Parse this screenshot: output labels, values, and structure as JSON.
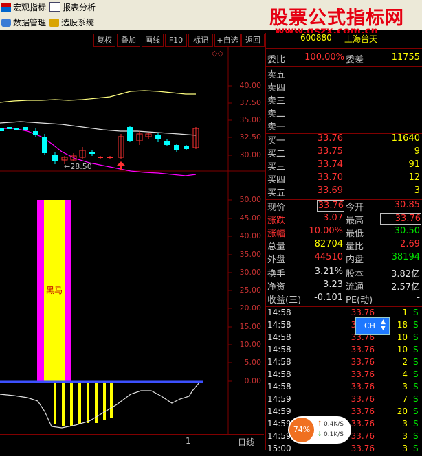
{
  "menu": {
    "item1": "宏观指标",
    "item2": "报表分析",
    "item3": "数据管理",
    "item4": "选股系统"
  },
  "watermark": {
    "title": "股票公式指标网",
    "url": "www.gszx.com.cn"
  },
  "toolbar": [
    "复权",
    "叠加",
    "画线",
    "F10",
    "标记",
    "+自选",
    "返回"
  ],
  "chart": {
    "price_axis": [
      "40.00",
      "37.50",
      "35.00",
      "32.50",
      "30.00"
    ],
    "low_label": "←28.50",
    "indicator_axis": [
      "50.00",
      "45.00",
      "40.00",
      "35.00",
      "30.00",
      "25.00",
      "20.00",
      "15.00",
      "10.00",
      "5.00",
      "0.00"
    ],
    "indicator_text": "黑马",
    "bottom_tab": "日线",
    "bottom_num": "1",
    "colors": {
      "upper": "#ffff80",
      "mid": "#e0e0e0",
      "lower": "#ff00ff",
      "candle_up": "#ff3232",
      "candle_down": "#00ffff",
      "bar_magenta": "#ff00ff",
      "bar_yellow": "#ffff00"
    }
  },
  "quote": {
    "header_code": "600880",
    "header_name": "上海普天",
    "weibi_label": "委比",
    "weibi": "100.00%",
    "weicha_label": "委差",
    "weicha": "11755",
    "sells": [
      {
        "label": "卖五"
      },
      {
        "label": "卖四"
      },
      {
        "label": "卖三"
      },
      {
        "label": "卖二"
      },
      {
        "label": "卖一"
      }
    ],
    "buys": [
      {
        "label": "买一",
        "price": "33.76",
        "vol": "11640"
      },
      {
        "label": "买二",
        "price": "33.75",
        "vol": "9"
      },
      {
        "label": "买三",
        "price": "33.74",
        "vol": "91"
      },
      {
        "label": "买四",
        "price": "33.70",
        "vol": "12"
      },
      {
        "label": "买五",
        "price": "33.69",
        "vol": "3"
      }
    ],
    "stats": [
      {
        "l1": "现价",
        "v1": "33.76",
        "l2": "今开",
        "v2": "30.85"
      },
      {
        "l1": "涨跌",
        "v1": "3.07",
        "l2": "最高",
        "v2": "33.76"
      },
      {
        "l1": "涨幅",
        "v1": "10.00%",
        "l2": "最低",
        "v2": "30.50"
      },
      {
        "l1": "总量",
        "v1": "82704",
        "l2": "量比",
        "v2": "2.69"
      },
      {
        "l1": "外盘",
        "v1": "44510",
        "l2": "内盘",
        "v2": "38194"
      }
    ],
    "stats2": [
      {
        "l1": "换手",
        "v1": "3.21%",
        "l2": "股本",
        "v2": "3.82亿"
      },
      {
        "l1": "净资",
        "v1": "3.23",
        "l2": "流通",
        "v2": "2.57亿"
      },
      {
        "l1": "收益(三)",
        "v1": "-0.101",
        "l2": "PE(动)",
        "v2": "-"
      }
    ],
    "ticks": [
      {
        "t": "14:58",
        "p": "33.76",
        "v": "1",
        "s": "S"
      },
      {
        "t": "14:58",
        "p": "33.76",
        "v": "18",
        "s": "S"
      },
      {
        "t": "14:58",
        "p": "33.76",
        "v": "10",
        "s": "S"
      },
      {
        "t": "14:58",
        "p": "33.76",
        "v": "10",
        "s": "S"
      },
      {
        "t": "14:58",
        "p": "33.76",
        "v": "2",
        "s": "S"
      },
      {
        "t": "14:58",
        "p": "33.76",
        "v": "4",
        "s": "S"
      },
      {
        "t": "14:58",
        "p": "33.76",
        "v": "3",
        "s": "S"
      },
      {
        "t": "14:59",
        "p": "33.76",
        "v": "7",
        "s": "S"
      },
      {
        "t": "14:59",
        "p": "33.76",
        "v": "20",
        "s": "S"
      },
      {
        "t": "14:59",
        "p": "33.76",
        "v": "3",
        "s": "S"
      },
      {
        "t": "14:59",
        "p": "33.76",
        "v": "3",
        "s": "S"
      },
      {
        "t": "15:00",
        "p": "33.76",
        "v": "3",
        "s": "S"
      }
    ]
  },
  "widgets": {
    "ch": "CH",
    "speed_pct": "74%",
    "up_speed": "0.4K/S",
    "down_speed": "0.1K/S"
  }
}
